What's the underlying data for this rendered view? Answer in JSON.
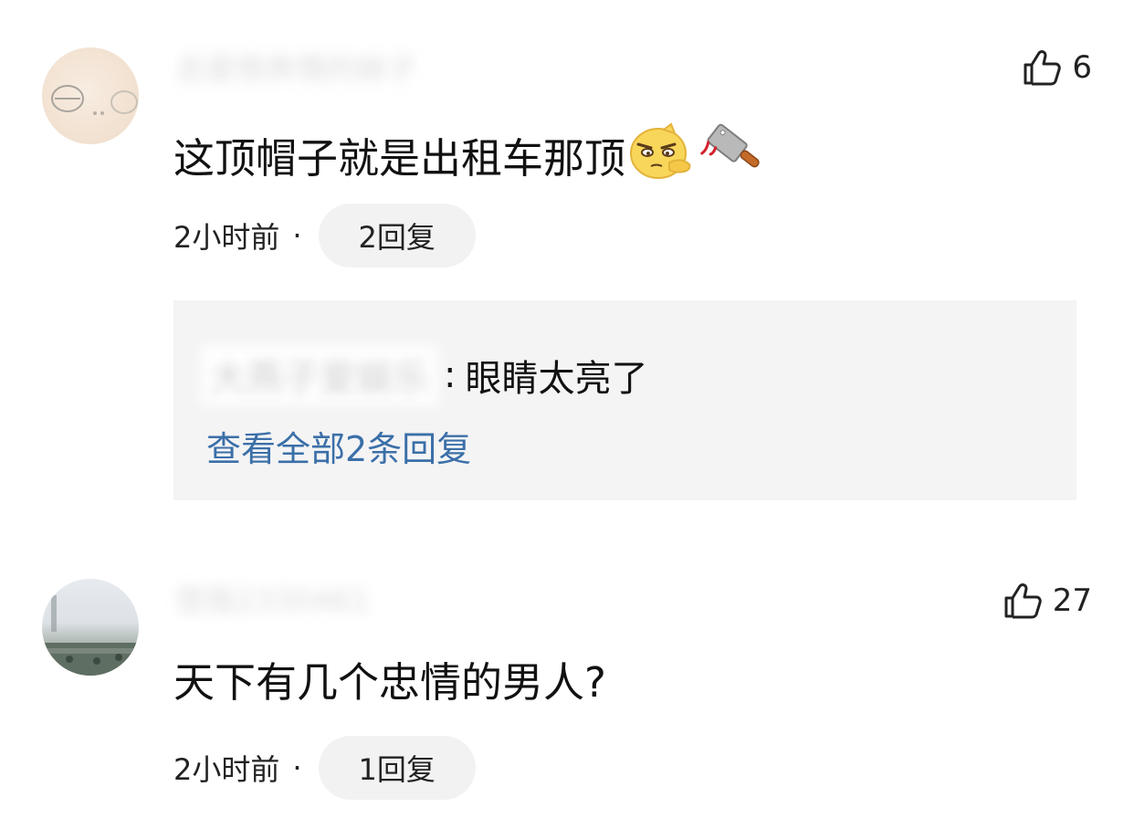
{
  "comments": [
    {
      "username": "总是恨奔情的妹子",
      "likes": "6",
      "text": "这顶帽子就是出租车那顶",
      "emojis": [
        "thinking-face-emoji",
        "cleaver-knife-emoji"
      ],
      "time": "2小时前",
      "separator": "·",
      "reply_button": "2回复",
      "replies_preview": {
        "username": "大燕子爱娱乐",
        "colon": ":",
        "text": "眼睛太亮了",
        "view_all": "查看全部2条回复"
      }
    },
    {
      "username": "悠哉2330461",
      "likes": "27",
      "text": "天下有几个忠情的男人?",
      "time": "2小时前",
      "separator": "·",
      "reply_button": "1回复"
    }
  ],
  "colors": {
    "link": "#3b6fa8",
    "reply_box_bg": "#f4f4f5",
    "pill_bg": "#f2f2f2",
    "text": "#111111"
  }
}
